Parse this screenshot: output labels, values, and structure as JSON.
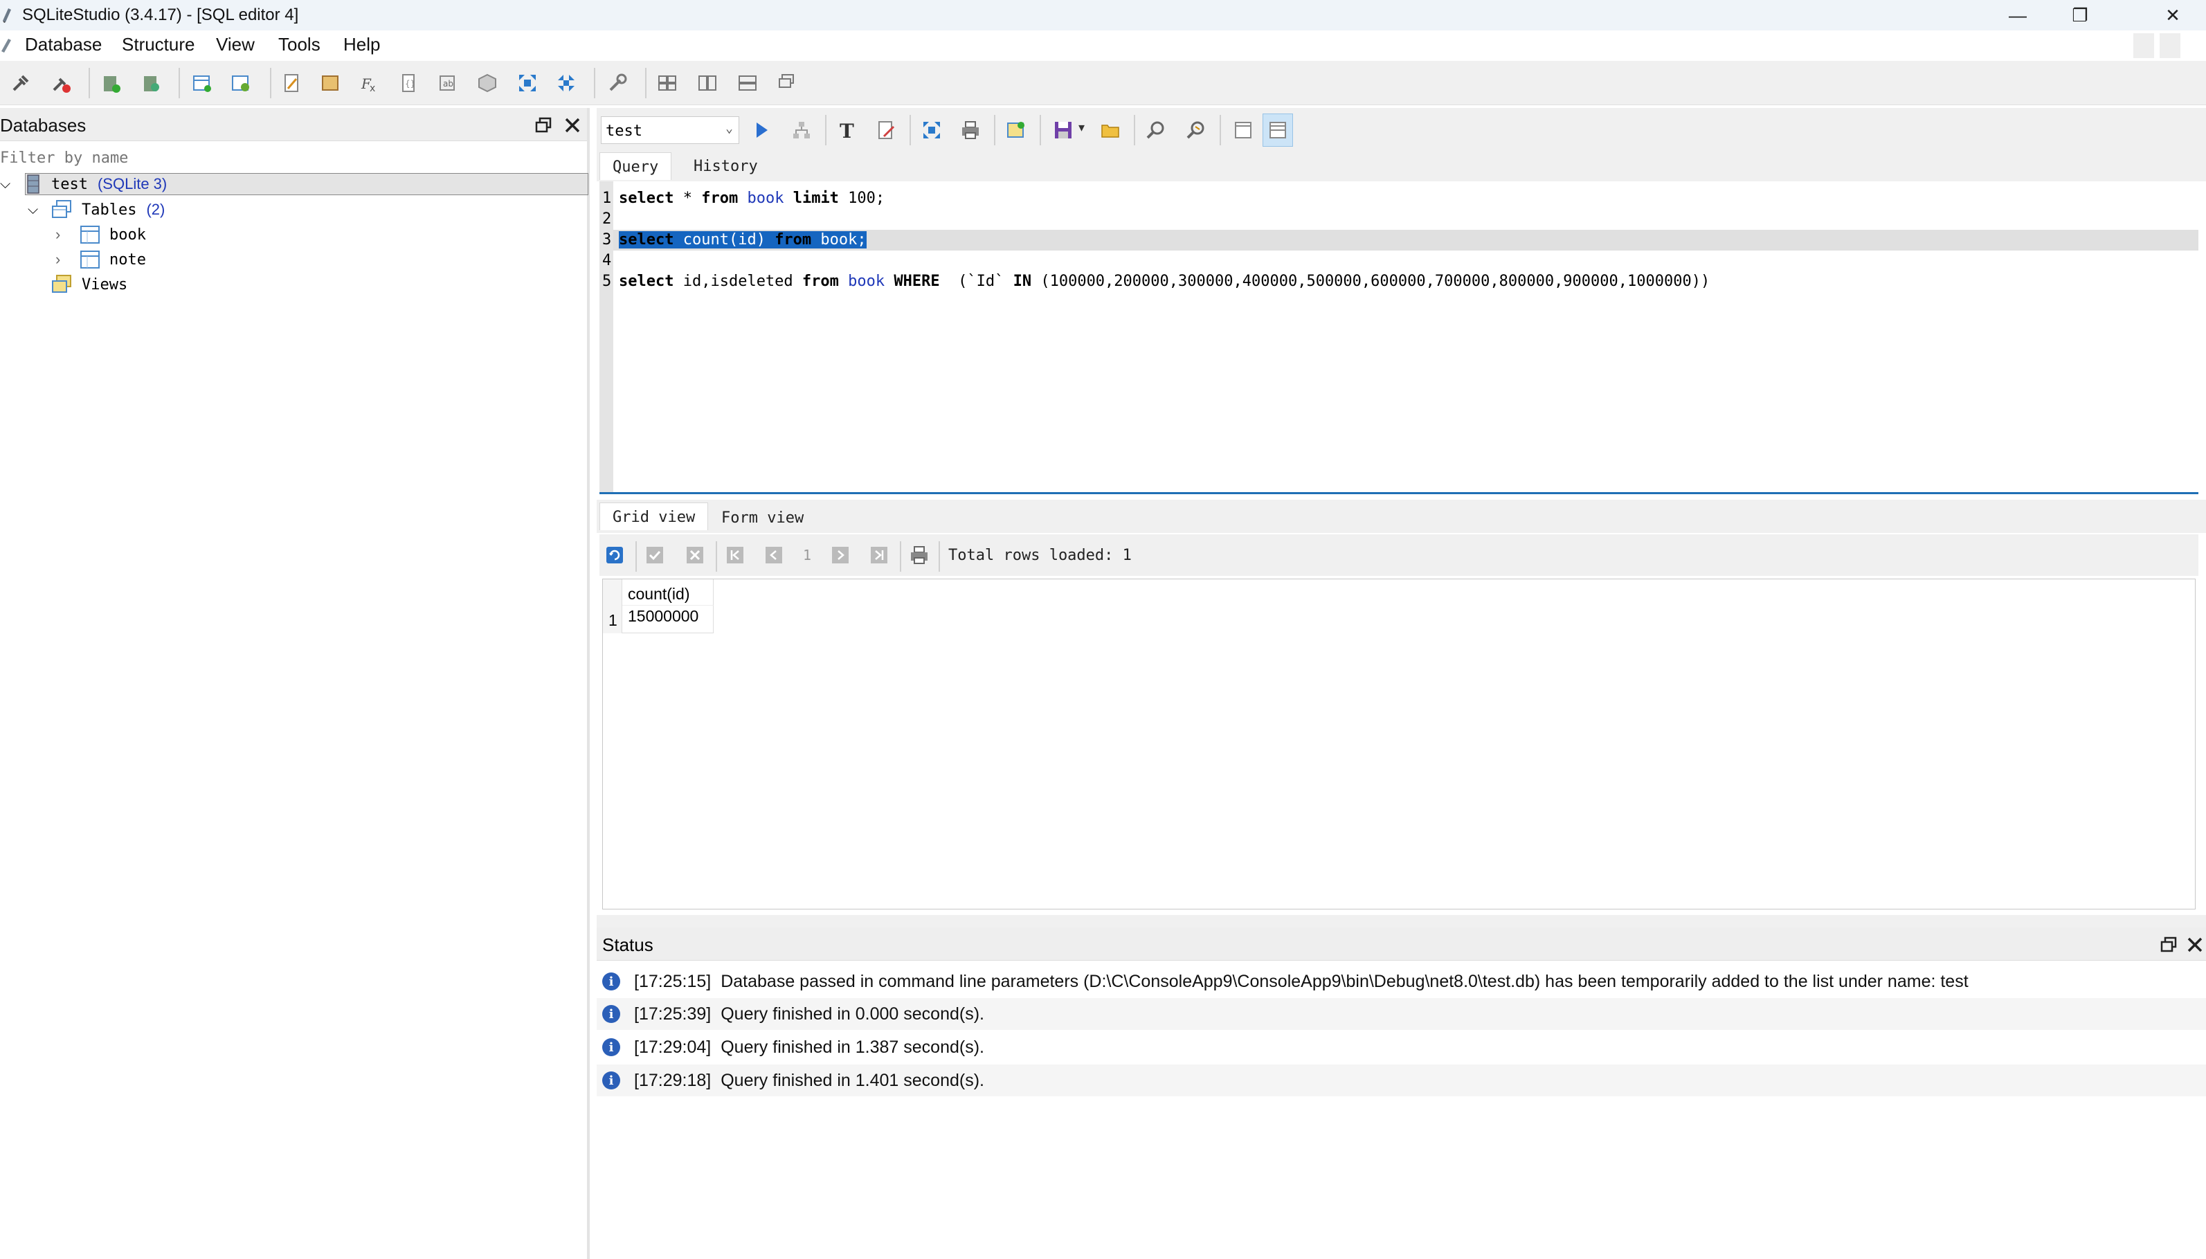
{
  "window": {
    "title": "SQLiteStudio (3.4.17) - [SQL editor 4]",
    "minimize": "—",
    "restore": "❐",
    "close": "✕"
  },
  "menu": [
    "Database",
    "Structure",
    "View",
    "Tools",
    "Help"
  ],
  "databases_panel": {
    "title": "Databases",
    "filter_placeholder": "Filter by name",
    "db_name": "test",
    "db_type": "(SQLite 3)",
    "tables_label": "Tables",
    "tables_count": "(2)",
    "tables": [
      "book",
      "note"
    ],
    "views_label": "Views"
  },
  "editor": {
    "database_select": "test",
    "tabs": [
      "Query",
      "History"
    ],
    "line_numbers": [
      "1",
      "2",
      "3",
      "4",
      "5"
    ],
    "lines": {
      "l1": {
        "k1": "select",
        "t1": " * ",
        "k2": "from",
        "sp": " ",
        "tbl": "book",
        "sp2": " ",
        "k3": "limit",
        "t2": " 100;"
      },
      "l3": {
        "k1": "select",
        "t1": " count(id) ",
        "k2": "from",
        "sp": " ",
        "tbl": "book",
        "t2": ";"
      },
      "l5": {
        "k1": "select",
        "t1": " id,isdeleted ",
        "k2": "from",
        "sp": " ",
        "tbl": "book",
        "sp2": " ",
        "k3": "WHERE",
        "t2": "  (`Id` ",
        "k4": "IN",
        "t3": " (100000,200000,300000,400000,500000,600000,700000,800000,900000,1000000))"
      }
    }
  },
  "results": {
    "tabs": [
      "Grid view",
      "Form view"
    ],
    "page": "1",
    "total_rows": "Total rows loaded: 1",
    "column": "count(id)",
    "row_number": "1",
    "value": "15000000"
  },
  "status": {
    "title": "Status",
    "messages": [
      {
        "time": "[17:25:15]",
        "text": "Database passed in command line parameters (D:\\C\\ConsoleApp9\\ConsoleApp9\\bin\\Debug\\net8.0\\test.db) has been temporarily added to the list under name: test"
      },
      {
        "time": "[17:25:39]",
        "text": "Query finished in 0.000 second(s)."
      },
      {
        "time": "[17:29:04]",
        "text": "Query finished in 1.387 second(s)."
      },
      {
        "time": "[17:29:18]",
        "text": "Query finished in 1.401 second(s)."
      }
    ]
  },
  "colors": {
    "selection": "#1565c0",
    "table_text": "#1f38b8",
    "info": "#2b5fb8",
    "editor_border": "#1f6fb5"
  }
}
